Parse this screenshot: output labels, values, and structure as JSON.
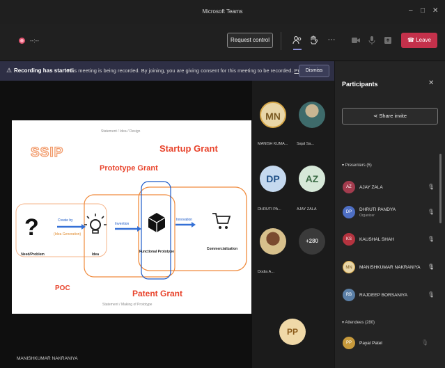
{
  "window": {
    "title": "Microsoft Teams",
    "controls": [
      "–",
      "□",
      "✕"
    ]
  },
  "callbar": {
    "timer": "--:--",
    "request_control": "Request control",
    "leave": "Leave",
    "icons": [
      "people-icon",
      "hand-icon",
      "more-icon",
      "camera-icon",
      "mic-icon",
      "share-icon",
      "phone-icon"
    ]
  },
  "banner": {
    "icon": "⚠",
    "bold": "Recording has started.",
    "message": "This meeting is being recorded. By joining, you are giving consent for this meeting to be recorded.",
    "privacy": "Priv...",
    "dismiss": "Dismiss"
  },
  "slide": {
    "top_caption": "Statement / Idea / Design",
    "ssip": "SSIP",
    "startup_grant": "Startup Grant",
    "prototype_grant": "Prototype Grant",
    "patent_grant": "Patent Grant",
    "poc": "POC",
    "bottom_caption": "Statement / Making of Prototype",
    "arrow_create": "Create by",
    "arrow_create_sub": "(Idea Generation)",
    "arrow_invention": "Invention",
    "arrow_innovation": "Innovation",
    "need": "Need/Problem",
    "idea": "Idea",
    "functional": "Functional Prototype",
    "commercial": "Commercialization"
  },
  "presenter_label": "MANISHKUMAR NAKRANIYA",
  "tiles": [
    {
      "initials": "MN",
      "name": "MANISH KUMA..."
    },
    {
      "initials": "",
      "name": "Sajal Sa..."
    },
    {
      "initials": "DP",
      "name": "DHRUTI PA..."
    },
    {
      "initials": "AZ",
      "name": "AJAY ZALA"
    },
    {
      "initials": "",
      "name": "Dodia A..."
    },
    {
      "initials": "+280",
      "name": ""
    },
    {
      "initials": "PP",
      "name": ""
    }
  ],
  "panel": {
    "title": "Participants",
    "share_invite": "Share invite",
    "presenters_header": "Presenters (5)",
    "presenters": [
      {
        "initials": "AZ",
        "name": "AJAY ZALA",
        "sub": ""
      },
      {
        "initials": "DP",
        "name": "DHRUTI PANDYA",
        "sub": "Organizer"
      },
      {
        "initials": "KS",
        "name": "KAUSHAL SHAH",
        "sub": ""
      },
      {
        "initials": "MN",
        "name": "MANISHKUMAR NAKRANIYA",
        "sub": ""
      },
      {
        "initials": "RB",
        "name": "RAJDEEP BORSANIYA",
        "sub": ""
      }
    ],
    "attendees_header": "Attendees (280)",
    "attendees": [
      {
        "initials": "PP",
        "name": "Payal Patel",
        "sub": ""
      }
    ]
  },
  "colors": {
    "leave": "#c4314b",
    "banner": "#2e2f45",
    "accent": "#8a8fd6",
    "slide_red": "#e8432b",
    "slide_orange": "#f08b3d",
    "slide_blue": "#1b59c7"
  }
}
